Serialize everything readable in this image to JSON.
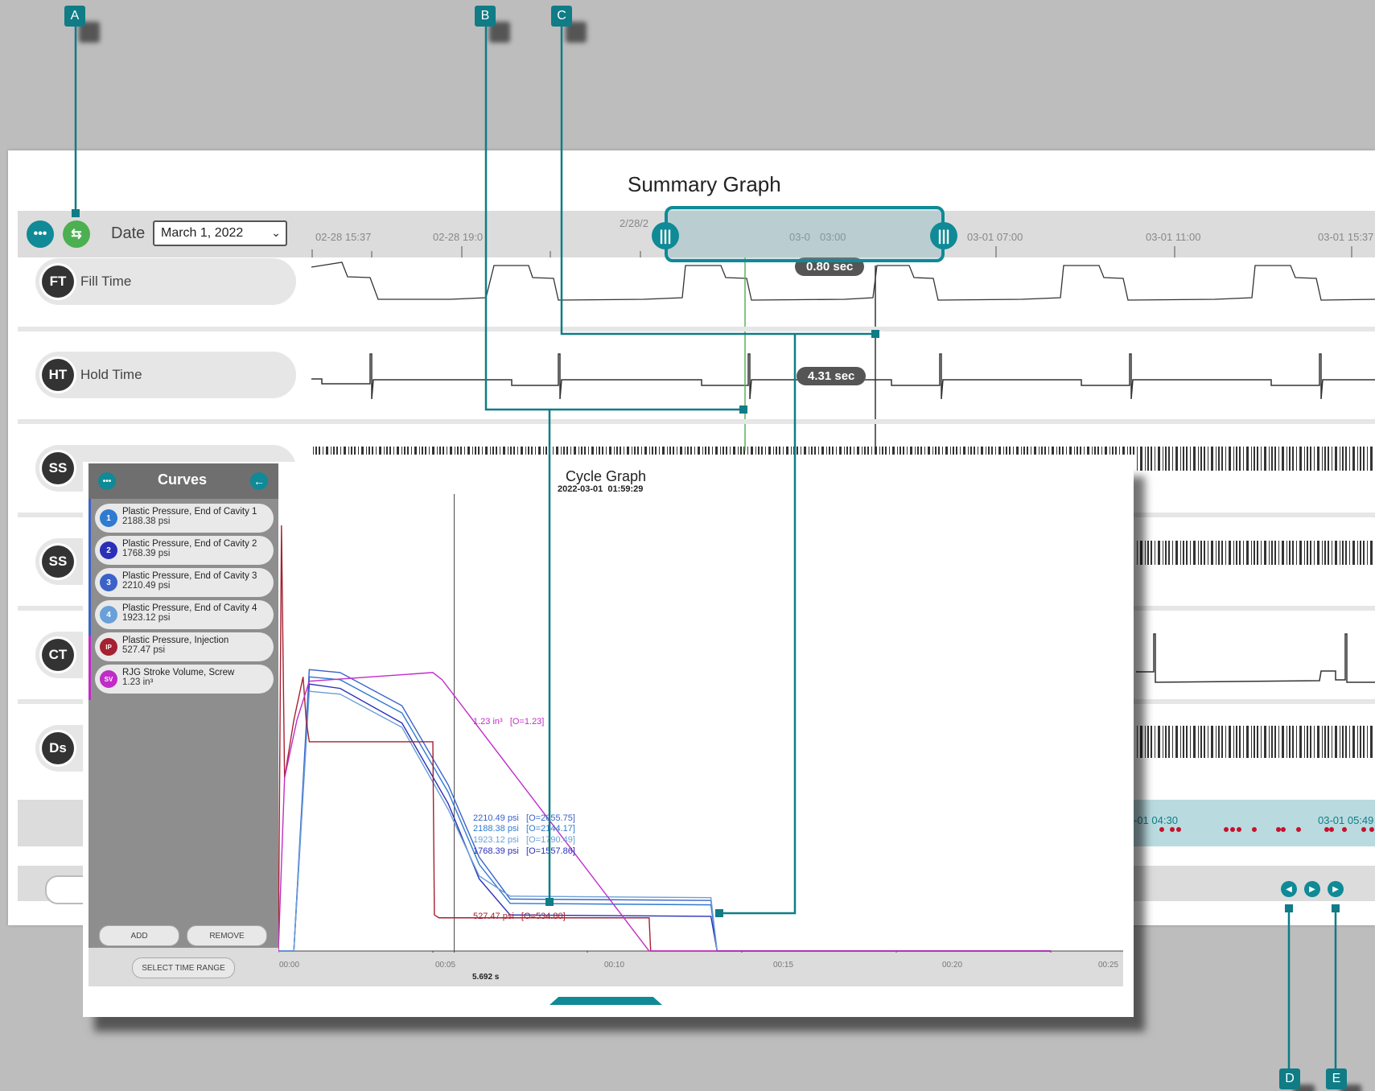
{
  "callouts": [
    "A",
    "B",
    "C",
    "D",
    "E"
  ],
  "summary": {
    "title": "Summary Graph",
    "date_label": "Date",
    "date_value": "March 1, 2022",
    "time_ticks": [
      "02-28 15:37",
      "02-28 19:0",
      "2/28/2",
      "03-0",
      "03:00",
      "03-01 07:00",
      "03-01 11:00",
      "03-01 15:37"
    ],
    "rows": [
      {
        "abbr": "FT",
        "name": "Fill Time"
      },
      {
        "abbr": "HT",
        "name": "Hold Time"
      },
      {
        "abbr": "SS",
        "name": ""
      },
      {
        "abbr": "SS",
        "name": ""
      },
      {
        "abbr": "CT",
        "name": ""
      },
      {
        "abbr": "Ds",
        "name": ""
      }
    ],
    "fill_tag": "0.80 sec",
    "hold_tag": "4.31 sec",
    "timeline_ticks": [
      "-01 04:30",
      "03-01 05:49"
    ]
  },
  "cycle": {
    "title": "Cycle Graph",
    "timestamp": "2022-03-01  01:59:29",
    "sidebar_title": "Curves",
    "curves": [
      {
        "badge": "1",
        "name": "Plastic Pressure, End of Cavity 1",
        "value": "2188.38 psi",
        "color": "#2f7bd0"
      },
      {
        "badge": "2",
        "name": "Plastic Pressure, End of Cavity 2",
        "value": "1768.39 psi",
        "color": "#2a2fb8"
      },
      {
        "badge": "3",
        "name": "Plastic Pressure, End of Cavity 3",
        "value": "2210.49 psi",
        "color": "#3a62c9"
      },
      {
        "badge": "4",
        "name": "Plastic Pressure, End of Cavity 4",
        "value": "1923.12 psi",
        "color": "#6aa0d8"
      },
      {
        "badge": "IP",
        "name": "Plastic Pressure, Injection",
        "value": "527.47 psi",
        "color": "#a52030"
      },
      {
        "badge": "SV",
        "name": "RJG Stroke Volume, Screw",
        "value": "1.23 in³",
        "color": "#c02cc8"
      }
    ],
    "add_label": "ADD",
    "remove_label": "REMOVE",
    "time_range_label": "SELECT TIME RANGE",
    "x_ticks": [
      "00:00",
      "00:05",
      "00:10",
      "00:15",
      "00:20",
      "00:25"
    ],
    "cursor_label": "5.692 s",
    "annotations": {
      "sv": "1.23 in³   [O=1.23]",
      "c3": "2210.49 psi   [O=2055.75]",
      "c1": "2188.38 psi   [O=2144.17]",
      "c4": "1923.12 psi   [O=1790.49]",
      "c2": "1768.39 psi   [O=1557.86]",
      "ip": "527.47 psi   [O=534.80]"
    },
    "chart_data": {
      "type": "line",
      "x_unit": "s",
      "xlim": [
        0,
        25
      ],
      "cursor_x": 5.692,
      "series": [
        {
          "name": "Plastic Pressure, End of Cavity 1",
          "x": [
            0,
            0.5,
            1.0,
            2.0,
            4.0,
            5.5,
            6.5,
            7.5,
            14.0,
            14.2,
            25
          ],
          "y": [
            0,
            0,
            1900,
            1880,
            1650,
            1100,
            600,
            330,
            320,
            0,
            0
          ]
        },
        {
          "name": "Plastic Pressure, End of Cavity 2",
          "x": [
            0,
            0.5,
            1.0,
            2.0,
            4.0,
            5.5,
            6.5,
            7.5,
            14.0,
            14.2,
            25
          ],
          "y": [
            0,
            0,
            1850,
            1820,
            1580,
            1020,
            500,
            250,
            240,
            0,
            0
          ]
        },
        {
          "name": "Plastic Pressure, End of Cavity 3",
          "x": [
            0,
            0.5,
            1.0,
            2.0,
            4.0,
            5.5,
            6.5,
            7.5,
            14.0,
            14.2,
            25
          ],
          "y": [
            0,
            0,
            1950,
            1930,
            1700,
            1150,
            650,
            360,
            350,
            0,
            0
          ]
        },
        {
          "name": "Plastic Pressure, End of Cavity 4",
          "x": [
            0,
            0.5,
            1.0,
            2.0,
            4.0,
            5.5,
            6.5,
            7.5,
            14.0,
            14.2,
            25
          ],
          "y": [
            0,
            0,
            1800,
            1780,
            1550,
            980,
            520,
            380,
            370,
            0,
            0
          ]
        },
        {
          "name": "Plastic Pressure, Injection",
          "x": [
            0,
            0.1,
            0.2,
            0.5,
            0.8,
            0.9,
            1.0,
            5.0,
            5.05,
            5.2,
            12.0,
            12.05,
            25
          ],
          "y": [
            0,
            2950,
            1200,
            1600,
            1900,
            1600,
            1450,
            1450,
            250,
            230,
            230,
            0,
            0
          ]
        },
        {
          "name": "RJG Stroke Volume, Screw",
          "x": [
            0,
            0.2,
            0.6,
            1.0,
            5.0,
            5.3,
            12.0,
            25
          ],
          "y": [
            0,
            1200,
            1600,
            1870,
            1930,
            1880,
            0,
            0
          ]
        }
      ]
    }
  }
}
